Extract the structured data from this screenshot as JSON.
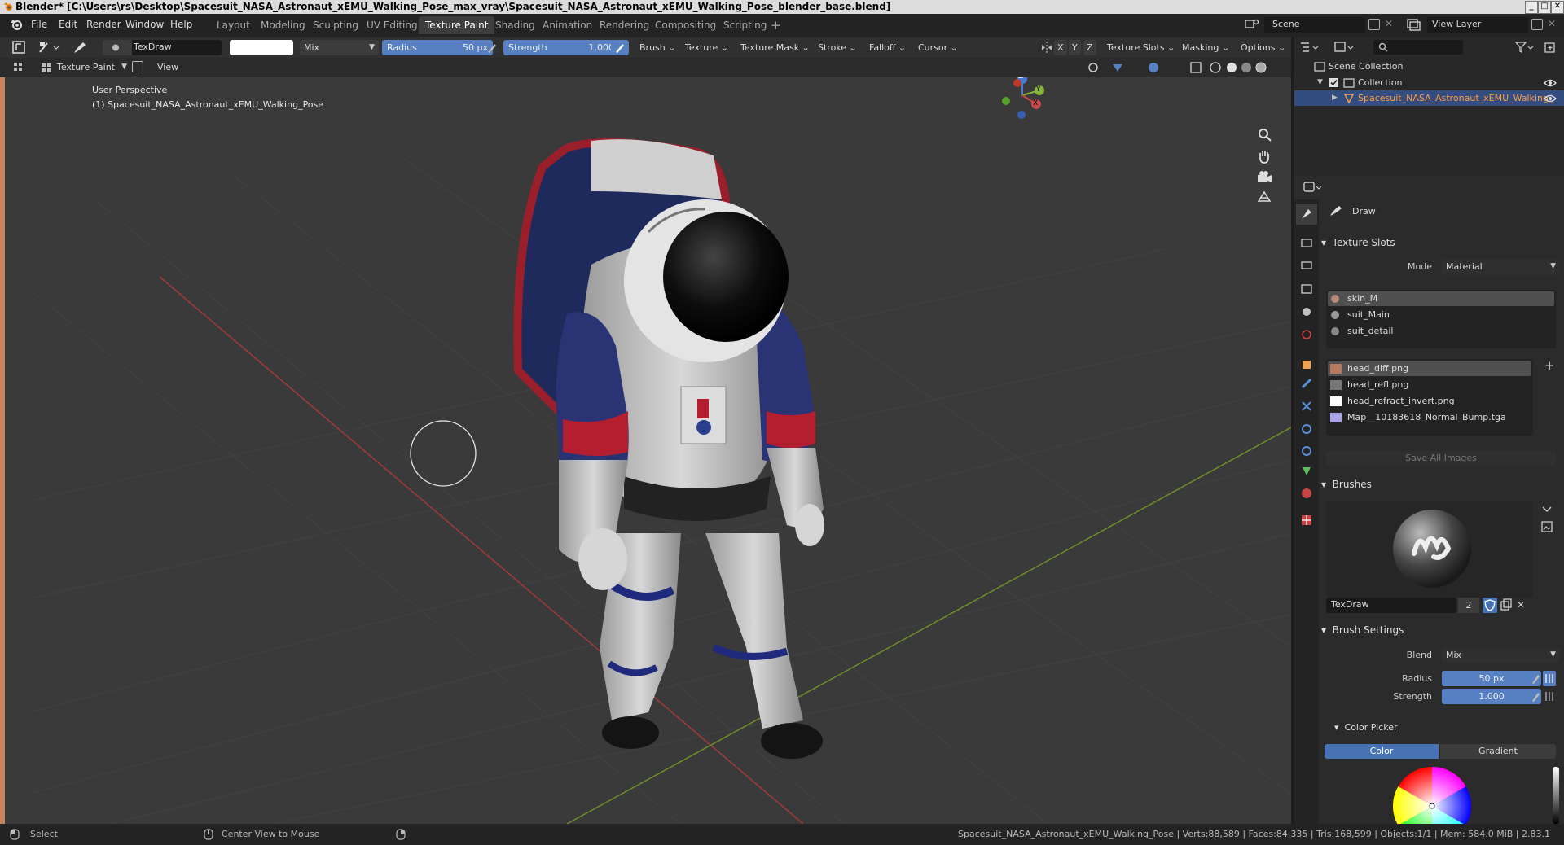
{
  "window": {
    "title": "Blender* [C:\\Users\\rs\\Desktop\\Spacesuit_NASA_Astronaut_xEMU_Walking_Pose_max_vray\\Spacesuit_NASA_Astronaut_xEMU_Walking_Pose_blender_base.blend]"
  },
  "menu": [
    "File",
    "Edit",
    "Render",
    "Window",
    "Help"
  ],
  "workspaces": [
    "Layout",
    "Modeling",
    "Sculpting",
    "UV Editing",
    "Texture Paint",
    "Shading",
    "Animation",
    "Rendering",
    "Compositing",
    "Scripting"
  ],
  "active_workspace": "Texture Paint",
  "scene": {
    "name": "Scene",
    "view_layer": "View Layer"
  },
  "tool_header": {
    "brush_name": "TexDraw",
    "blend": "Mix",
    "radius_label": "Radius",
    "radius_value": "50 px",
    "strength_label": "Strength",
    "strength_value": "1.000",
    "menus": [
      "Brush",
      "Texture",
      "Texture Mask",
      "Stroke",
      "Falloff",
      "Cursor"
    ],
    "axes": [
      "X",
      "Y",
      "Z"
    ],
    "right_menus": [
      "Texture Slots",
      "Masking",
      "Options"
    ]
  },
  "header2": {
    "mode": "Texture Paint",
    "view": "View"
  },
  "viewport": {
    "perspective": "User Perspective",
    "object_label": "(1) Spacesuit_NASA_Astronaut_xEMU_Walking_Pose"
  },
  "gizmo": {
    "z": "Z",
    "y": "Y",
    "x": "X"
  },
  "outliner": {
    "scene_collection": "Scene Collection",
    "collection": "Collection",
    "object": "Spacesuit_NASA_Astronaut_xEMU_Walking_"
  },
  "properties": {
    "tool_name": "Draw",
    "texture_slots_title": "Texture Slots",
    "mode_label": "Mode",
    "mode_value": "Material",
    "materials": [
      "skin_M",
      "suit_Main",
      "suit_detail"
    ],
    "images": [
      "head_diff.png",
      "head_refl.png",
      "head_refract_invert.png",
      "Map__10183618_Normal_Bump.tga"
    ],
    "save_all": "Save All Images",
    "brushes_title": "Brushes",
    "brush_name": "TexDraw",
    "brush_users": "2",
    "brush_settings_title": "Brush Settings",
    "blend_label": "Blend",
    "blend_value": "Mix",
    "radius_label": "Radius",
    "radius_value": "50 px",
    "strength_label": "Strength",
    "strength_value": "1.000",
    "color_picker_title": "Color Picker",
    "color_tab": "Color",
    "gradient_tab": "Gradient"
  },
  "status": {
    "left1": "Select",
    "left2": "Center View to Mouse",
    "right": "Spacesuit_NASA_Astronaut_xEMU_Walking_Pose | Verts:88,589 | Faces:84,335 | Tris:168,599 | Objects:1/1 | Mem: 584.0 MiB | 2.83.1"
  },
  "colors": {
    "accent": "#4772b3",
    "slider": "#5680c2",
    "axis_x": "#c84a4a",
    "axis_y": "#86b43a"
  }
}
